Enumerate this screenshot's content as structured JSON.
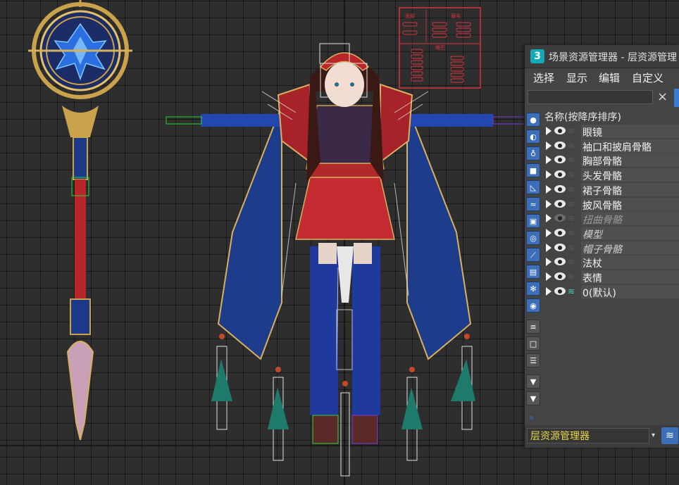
{
  "panel": {
    "app_icon": "3",
    "title": "场景资源管理器 - 层资源管理",
    "menu": [
      "选择",
      "显示",
      "编辑",
      "自定义"
    ],
    "search_placeholder": "",
    "clear_icon": "×",
    "column_header": "名称(按降序排序)",
    "layers": [
      {
        "name": "眼镜",
        "visible": true,
        "style": "normal"
      },
      {
        "name": "袖口和披肩骨骼",
        "visible": true,
        "style": "normal"
      },
      {
        "name": "胸部骨骼",
        "visible": true,
        "style": "normal"
      },
      {
        "name": "头发骨骼",
        "visible": true,
        "style": "normal"
      },
      {
        "name": "裙子骨骼",
        "visible": true,
        "style": "normal"
      },
      {
        "name": "披风骨骼",
        "visible": true,
        "style": "normal"
      },
      {
        "name": "扭曲骨骼",
        "visible": false,
        "style": "dim"
      },
      {
        "name": "模型",
        "visible": true,
        "style": "italic"
      },
      {
        "name": "帽子骨骼",
        "visible": true,
        "style": "italic"
      },
      {
        "name": "法杖",
        "visible": true,
        "style": "normal"
      },
      {
        "name": "表情",
        "visible": true,
        "style": "normal"
      },
      {
        "name": "0(默认)",
        "visible": true,
        "style": "active"
      }
    ],
    "bottom_label": "层资源管理器",
    "accent": "#3d6fb8",
    "active_layer_color": "#3bd1c4",
    "label_color": "#e8d84a"
  },
  "viewport": {
    "background": "#2e2e2e",
    "rig_panel_texts": [
      "面部",
      "眉毛",
      "嘴巴"
    ]
  }
}
